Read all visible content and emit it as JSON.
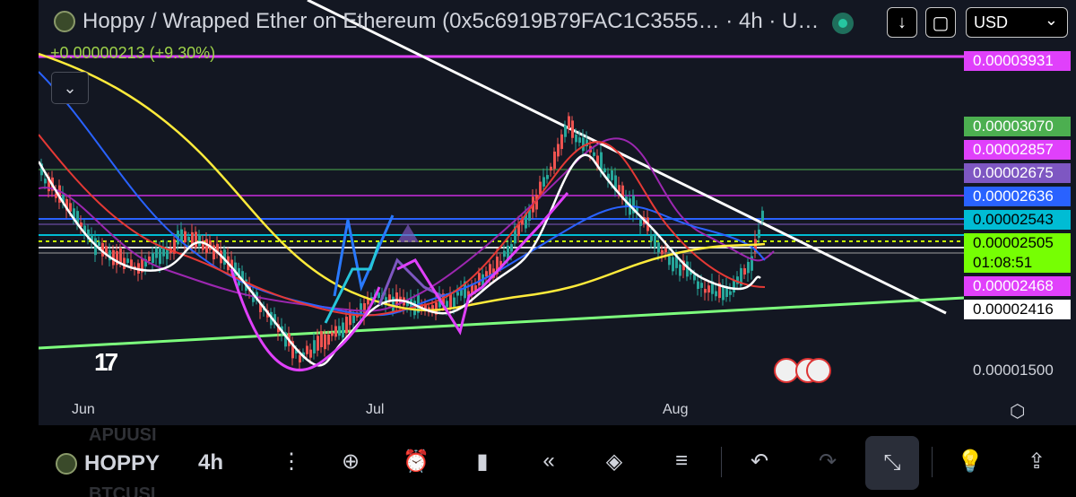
{
  "header": {
    "title": "Hoppy / Wrapped Ether on Ethereum (0x5c6919B79FAC1C3555… · 4h · U…",
    "change": "+0.00000213 (+9.30%)",
    "currency": "USD",
    "collapse_icon": "chevron-down-icon"
  },
  "price_labels": [
    {
      "text": "0.00003931",
      "bg": "#e040fb",
      "fg": "#ffffff"
    },
    {
      "text": "0.00003070",
      "bg": "#4caf50",
      "fg": "#ffffff"
    },
    {
      "text": "0.00002857",
      "bg": "#e040fb",
      "fg": "#ffffff"
    },
    {
      "text": "0.00002675",
      "bg": "#7e57c2",
      "fg": "#ffffff"
    },
    {
      "text": "0.00002636",
      "bg": "#2962ff",
      "fg": "#ffffff"
    },
    {
      "text": "0.00002543",
      "bg": "#00bcd4",
      "fg": "#000000"
    },
    {
      "text": "0.00002505",
      "bg": "#76ff03",
      "fg": "#000000"
    },
    {
      "text": "01:08:51",
      "bg": "#76ff03",
      "fg": "#000000"
    },
    {
      "text": "0.00002468",
      "bg": "#e040fb",
      "fg": "#ffffff"
    },
    {
      "text": "0.00002416",
      "bg": "#ffffff",
      "fg": "#000000"
    },
    {
      "text": "0.00001500",
      "bg": "transparent",
      "fg": "#d1d4dc"
    }
  ],
  "time_labels": [
    "Jun",
    "Jul",
    "Aug"
  ],
  "toolbar": {
    "symbol": "HOPPY",
    "timeframe": "4h",
    "ghost_top": "APUUSI",
    "ghost_bottom": "BTCUSI",
    "icons": [
      "more-vertical-icon",
      "add-indicator-icon",
      "alert-clock-icon",
      "candles-icon",
      "replay-icon",
      "layers-icon",
      "settings-sliders-icon",
      "undo-icon",
      "redo-icon",
      "exit-fullscreen-icon",
      "lightbulb-icon",
      "share-icon"
    ]
  },
  "colors": {
    "background": "#131722",
    "up": "#26a69a",
    "down": "#ef5350",
    "ema_white": "#ffffff",
    "ema_yellow": "#ffeb3b",
    "ema_red": "#e53935",
    "ema_blue": "#2962ff",
    "ema_purple": "#9c27b0"
  }
}
